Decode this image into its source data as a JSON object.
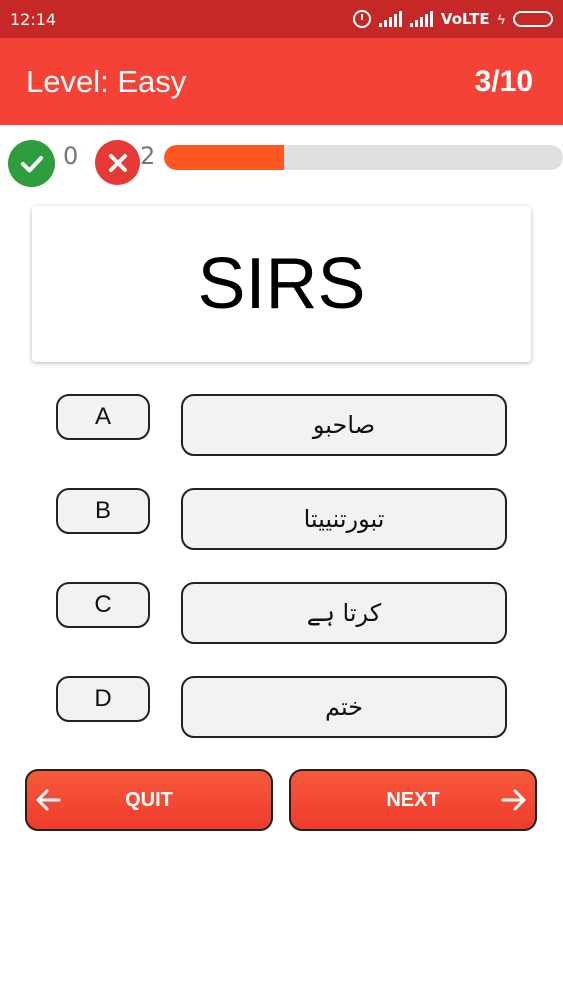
{
  "status_bar": {
    "time": "12:14",
    "network": "VoLTE",
    "icons": [
      "alarm-icon",
      "signal-icon",
      "signal-icon",
      "charging-icon",
      "battery-icon"
    ]
  },
  "header": {
    "level": "Level: Easy",
    "progress": "3/10"
  },
  "score": {
    "correct_count": "0",
    "wrong_count": "2",
    "progress_fraction": 0.3
  },
  "question": {
    "word": "SIRS"
  },
  "options": [
    {
      "letter": "A",
      "answer": "صاحبو"
    },
    {
      "letter": "B",
      "answer": "تبورتنییتا"
    },
    {
      "letter": "C",
      "answer": "کرتا ہے"
    },
    {
      "letter": "D",
      "answer": "ختم"
    }
  ],
  "actions": {
    "quit_label": "QUIT",
    "next_label": "NEXT"
  },
  "colors": {
    "status_bar": "#c62828",
    "app_bar": "#f44336",
    "correct": "#2e9e3c",
    "wrong": "#e53935",
    "progress_fill": "#ff5722",
    "button": "#f44336"
  }
}
